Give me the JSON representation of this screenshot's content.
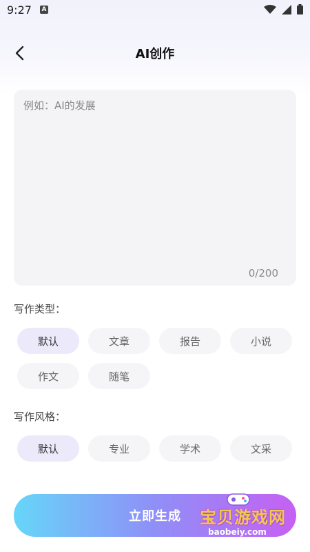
{
  "status_bar": {
    "time": "9:27",
    "notification_letter": "A"
  },
  "header": {
    "title": "AI创作"
  },
  "input": {
    "placeholder": "例如：AI的发展",
    "value": "",
    "counter": "0/200"
  },
  "writing_type": {
    "label": "写作类型：",
    "options": [
      "默认",
      "文章",
      "报告",
      "小说",
      "作文",
      "随笔"
    ],
    "selected": "默认"
  },
  "writing_style": {
    "label": "写作风格：",
    "options": [
      "默认",
      "专业",
      "学术",
      "文采"
    ],
    "selected": "默认"
  },
  "generate_button": {
    "label": "立即生成"
  },
  "watermark": {
    "text": "宝贝游戏网",
    "url": "baobeiy.com"
  },
  "colors": {
    "chip_selected": "#ece9fb",
    "chip_default": "#f5f5f7",
    "button_gradient_start": "#66d6f9",
    "button_gradient_end": "#c660f3"
  }
}
